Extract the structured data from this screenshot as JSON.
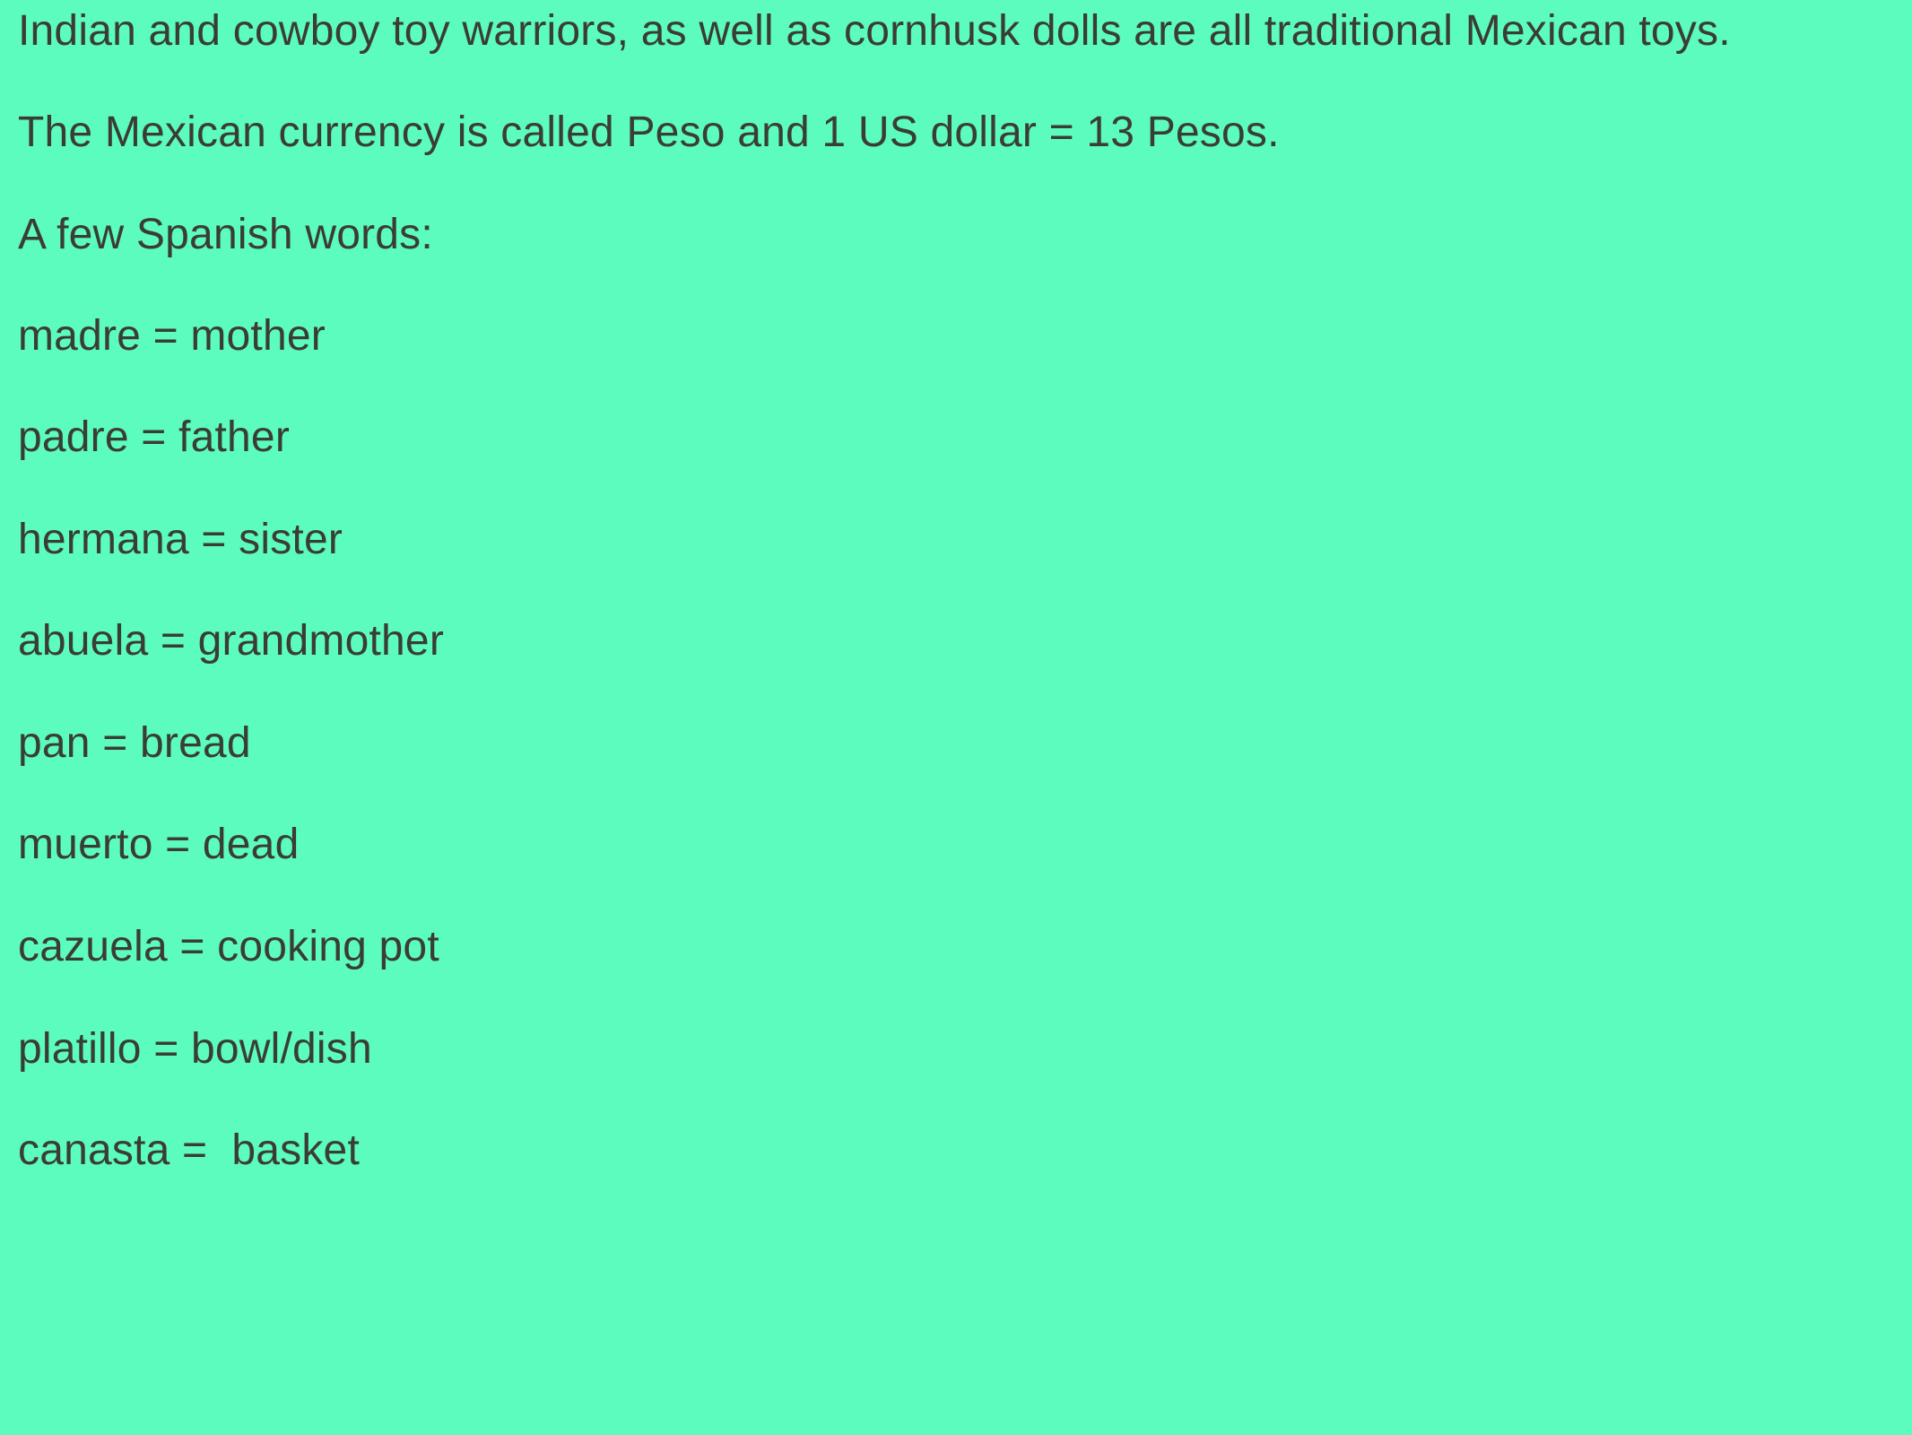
{
  "paragraphs": {
    "toys": "Indian and cowboy toy warriors, as well as cornhusk dolls are all traditional Mexican toys.",
    "currency": "The Mexican currency is called Peso and 1 US dollar = 13 Pesos.",
    "intro": "A few Spanish words:"
  },
  "vocabulary": [
    "madre = mother",
    "padre = father",
    "hermana = sister",
    "abuela = grandmother",
    "pan = bread",
    "muerto = dead",
    "cazuela = cooking pot",
    "platillo = bowl/dish",
    "canasta =  basket"
  ],
  "colors": {
    "background": "#5cfcbc",
    "text": "#3a3d34"
  }
}
